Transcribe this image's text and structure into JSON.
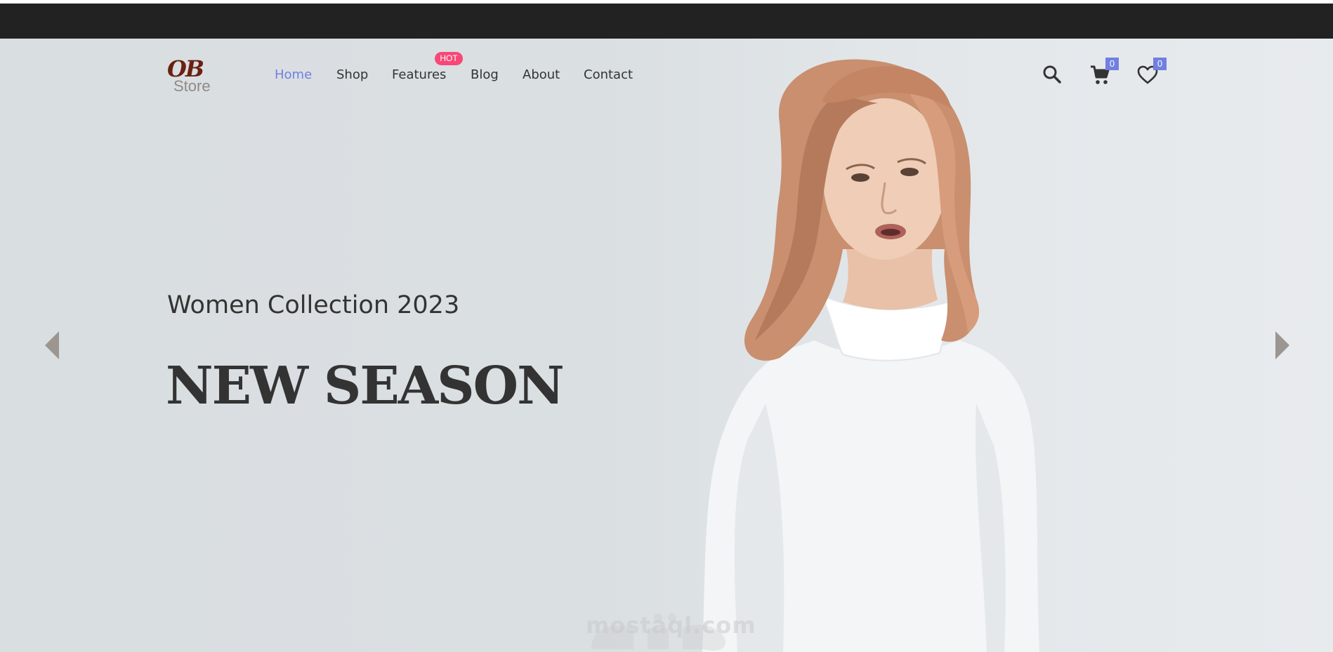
{
  "logo": {
    "script": "OB",
    "word": "Store"
  },
  "nav": {
    "items": [
      {
        "label": "Home",
        "active": true
      },
      {
        "label": "Shop",
        "active": false
      },
      {
        "label": "Features",
        "active": false
      },
      {
        "label": "Blog",
        "active": false
      },
      {
        "label": "About",
        "active": false
      },
      {
        "label": "Contact",
        "active": false
      }
    ],
    "features_badge": "HOT"
  },
  "header_icons": {
    "search": "search-icon",
    "cart": {
      "icon": "cart-icon",
      "count": "0"
    },
    "wishlist": {
      "icon": "heart-icon",
      "count": "0"
    }
  },
  "hero": {
    "subtitle": "Women Collection 2023",
    "headline": "NEW SEASON",
    "prev_icon": "arrow-left-icon",
    "next_icon": "arrow-right-icon"
  },
  "watermark": {
    "script": "مستقل",
    "text": "mostaql.com"
  },
  "colors": {
    "accent": "#717fe0",
    "badge": "#f74877",
    "top_bar": "#222222",
    "hero_background": "#dadfe2",
    "text": "#333333"
  }
}
